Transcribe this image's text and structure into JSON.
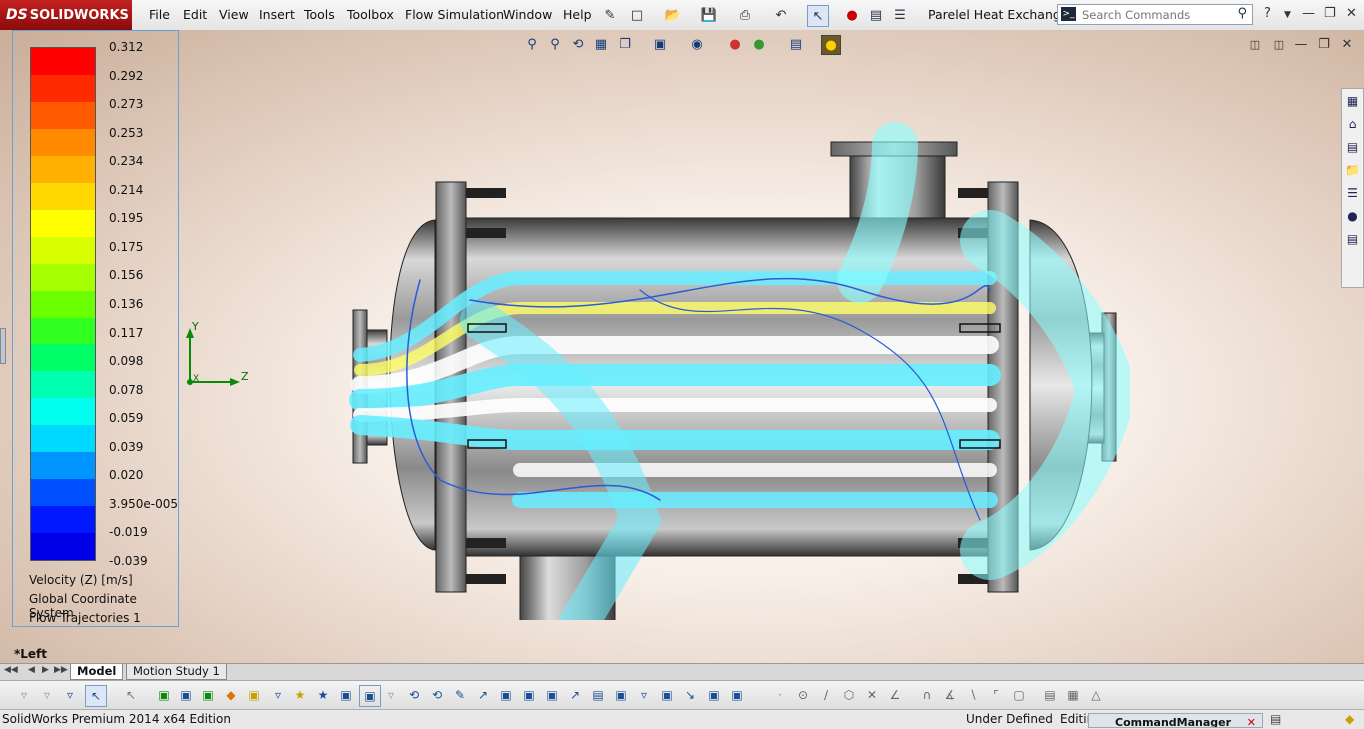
{
  "app": {
    "logo_prefix": "DS",
    "logo_text": "SOLIDWORKS",
    "document_title": "Parelel Heat Exchange..."
  },
  "menu": [
    "File",
    "Edit",
    "View",
    "Insert",
    "Tools",
    "Toolbox",
    "Flow Simulation",
    "Window",
    "Help"
  ],
  "search": {
    "placeholder": "Search Commands"
  },
  "legend": {
    "ticks": [
      "0.312",
      "0.292",
      "0.273",
      "0.253",
      "0.234",
      "0.214",
      "0.195",
      "0.175",
      "0.156",
      "0.136",
      "0.117",
      "0.098",
      "0.078",
      "0.059",
      "0.039",
      "0.020",
      "3.950e-005",
      "-0.019",
      "-0.039"
    ],
    "colors": [
      "#ff0000",
      "#ff2a00",
      "#ff5a00",
      "#ff8a00",
      "#ffb000",
      "#ffd800",
      "#ffff00",
      "#d8ff00",
      "#a6ff00",
      "#6cff00",
      "#30ff20",
      "#00ff66",
      "#00ffb0",
      "#00ffee",
      "#00d8ff",
      "#0094ff",
      "#0050ff",
      "#0018ff",
      "#0000e8"
    ],
    "quantity": "Velocity (Z) [m/s]",
    "coord_system": "Global Coordinate System",
    "plot_name": "Flow Trajectories 1"
  },
  "triad": {
    "y": "Y",
    "x": "X",
    "z": "Z"
  },
  "view_name": "*Left",
  "tabs": [
    {
      "label": "Model"
    },
    {
      "label": "Motion Study 1"
    }
  ],
  "status": {
    "edition": "SolidWorks Premium 2014 x64 Edition",
    "state": "Under Defined",
    "editing": "Editin",
    "command_manager": "CommandManager"
  }
}
